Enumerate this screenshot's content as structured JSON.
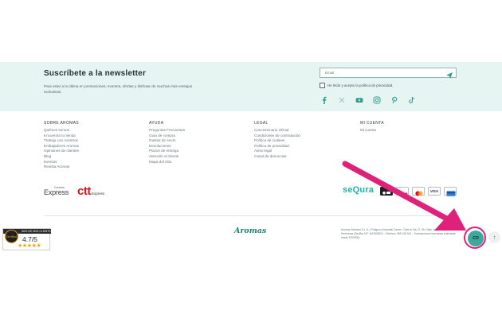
{
  "newsletter": {
    "title": "Suscríbete a la newsletter",
    "description": "Para estar a la última en promociones, eventos, ofertas y disfrutar de muchas más ventajas exclusivas.",
    "email_placeholder": "Email",
    "privacy_label": "He leído y acepto la política de privacidad.",
    "social_icons": [
      "facebook-icon",
      "x-icon",
      "youtube-icon",
      "instagram-icon",
      "pinterest-icon",
      "tiktok-icon"
    ]
  },
  "footer_columns": [
    {
      "heading": "SOBRE AROMAS",
      "links": [
        "Quiénes somos",
        "Encuentra tu tienda",
        "Trabaja con nosotros",
        "Embajadores Aromas",
        "Opiniones de clientes",
        "Blog",
        "Eventos",
        "Revista Aromas"
      ]
    },
    {
      "heading": "AYUDA",
      "links": [
        "Preguntas Frecuentes",
        "Guía de compra",
        "Gastos de envío",
        "Devoluciones",
        "Plazos de entrega",
        "Atención al cliente",
        "Mapa del sitio"
      ]
    },
    {
      "heading": "LEGAL",
      "links": [
        "Concesionario Oficial",
        "Condiciones de contratación",
        "Política de cookies",
        "Política de privacidad",
        "Aviso legal",
        "Canal de denuncias"
      ]
    },
    {
      "heading": "MI CUENTA",
      "links": [
        "Mi cuenta"
      ]
    }
  ],
  "shipping": {
    "correos_small": "Correos",
    "correos_big": "Express",
    "ctt": "ctt",
    "ctt_suffix": "Express"
  },
  "payments": {
    "sequra": "seQura",
    "cards": [
      "apple-pay-icon",
      "google-pay-icon",
      "mastercard-icon",
      "visa-icon",
      "card-icon"
    ],
    "visa_label": "VISA"
  },
  "rating": {
    "header": "AVIS DE NOS CLIENTS",
    "brand": "Verified",
    "score": "4.7/5",
    "stars": "★★★★★"
  },
  "brand": {
    "name": "Aromas"
  },
  "legal_text": "Aromas Selectos S.L.U. | Polígono Industrial Carrús, Calle la Sal, Cl. Ric Viejo, s/n. 41700 Dos Hermanas (Sevilla) CIF: B41508241 - Teléfono: 955 135 541 - Transacciones bancarias realizadas desde ESPAÑA.",
  "floating": {
    "cookie_label": "CO",
    "back_to_top": "↑"
  },
  "colors": {
    "accent": "#2f9c92",
    "newsletter_bg": "#e6f4f2",
    "annotation": "#e0217a"
  }
}
